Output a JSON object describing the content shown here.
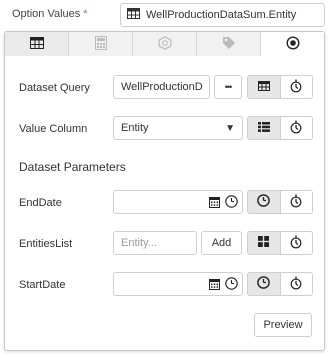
{
  "field": {
    "label": "Option Values",
    "required_mark": "*",
    "selected_value": "WellProductionDataSum.Entity"
  },
  "tabs": [
    {
      "icon": "table-icon",
      "active": true
    },
    {
      "icon": "calculator-icon",
      "active": false
    },
    {
      "icon": "hexagon-icon",
      "active": false
    },
    {
      "icon": "tag-icon",
      "active": false
    },
    {
      "icon": "radio-icon",
      "active": true
    }
  ],
  "dataset_query": {
    "label": "Dataset Query",
    "value": "WellProductionD",
    "more_label": "•••"
  },
  "value_column": {
    "label": "Value Column",
    "selected": "Entity"
  },
  "parameters": {
    "title": "Dataset Parameters",
    "end_date": {
      "label": "EndDate",
      "value": ""
    },
    "entities_list": {
      "label": "EntitiesList",
      "placeholder": "Entity...",
      "add_label": "Add"
    },
    "start_date": {
      "label": "StartDate",
      "value": ""
    }
  },
  "preview_label": "Preview",
  "colors": {
    "border": "#cfcfcf",
    "active_segment": "#e6e6e6",
    "required": "#d9534f"
  }
}
